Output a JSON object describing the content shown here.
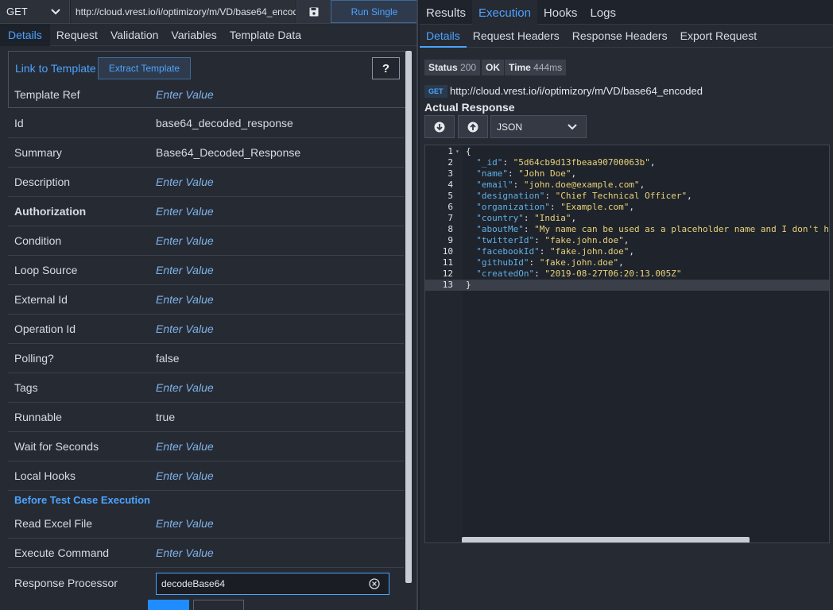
{
  "request_bar": {
    "method": "GET",
    "url": "http://cloud.vrest.io/i/optimizory/m/VD/base64_encoded",
    "run_label": "Run Single"
  },
  "left_tabs": [
    "Details",
    "Request",
    "Validation",
    "Variables",
    "Template Data"
  ],
  "template": {
    "link_label": "Link to Template",
    "extract_label": "Extract Template",
    "help_label": "?",
    "ref_label": "Template Ref",
    "ref_value": "Enter Value"
  },
  "fields": [
    {
      "label": "Id",
      "value": "base64_decoded_response"
    },
    {
      "label": "Summary",
      "value": "Base64_Decoded_Response"
    },
    {
      "label": "Description",
      "value": "Enter Value"
    },
    {
      "label": "Authorization",
      "value": "Enter Value"
    },
    {
      "label": "Condition",
      "value": "Enter Value"
    },
    {
      "label": "Loop Source",
      "value": "Enter Value"
    },
    {
      "label": "External Id",
      "value": "Enter Value"
    },
    {
      "label": "Operation Id",
      "value": "Enter Value"
    },
    {
      "label": "Polling?",
      "value": "false"
    },
    {
      "label": "Tags",
      "value": "Enter Value"
    },
    {
      "label": "Runnable",
      "value": "true"
    },
    {
      "label": "Wait for Seconds",
      "value": "Enter Value"
    },
    {
      "label": "Local Hooks",
      "value": "Enter Value"
    }
  ],
  "before_section": {
    "title": "Before Test Case Execution",
    "fields": [
      {
        "label": "Read Excel File",
        "value": "Enter Value"
      },
      {
        "label": "Execute Command",
        "value": "Enter Value"
      }
    ],
    "processor_label": "Response Processor",
    "processor_value": "decodeBase64"
  },
  "right_tabs": [
    "Results",
    "Execution",
    "Hooks",
    "Logs"
  ],
  "right_subtabs": [
    "Details",
    "Request Headers",
    "Response Headers",
    "Export Request"
  ],
  "status": {
    "status_label": "Status",
    "status_code": "200",
    "status_text": "OK",
    "time_label": "Time",
    "time_value": "444ms"
  },
  "request_line": {
    "method": "GET",
    "url": "http://cloud.vrest.io/i/optimizory/m/VD/base64_encoded"
  },
  "actual_response": {
    "title": "Actual Response",
    "format": "JSON"
  },
  "response_lines": [
    {
      "n": "1",
      "text": "{"
    },
    {
      "n": "2",
      "key": "\"_id\"",
      "val": "\"5d64cb9d13fbeaa90700063b\"",
      "end": ","
    },
    {
      "n": "3",
      "key": "\"name\"",
      "val": "\"John Doe\"",
      "end": ","
    },
    {
      "n": "4",
      "key": "\"email\"",
      "val": "\"john.doe@example.com\"",
      "end": ","
    },
    {
      "n": "5",
      "key": "\"designation\"",
      "val": "\"Chief Technical Officer\"",
      "end": ","
    },
    {
      "n": "6",
      "key": "\"organization\"",
      "val": "\"Example.com\"",
      "end": ","
    },
    {
      "n": "7",
      "key": "\"country\"",
      "val": "\"India\"",
      "end": ","
    },
    {
      "n": "8",
      "key": "\"aboutMe\"",
      "val": "\"My name can be used as a placeholder name and I don't ha",
      "end": ""
    },
    {
      "n": "9",
      "key": "\"twitterId\"",
      "val": "\"fake.john.doe\"",
      "end": ","
    },
    {
      "n": "10",
      "key": "\"facebookId\"",
      "val": "\"fake.john.doe\"",
      "end": ","
    },
    {
      "n": "11",
      "key": "\"githubId\"",
      "val": "\"fake.john.doe\"",
      "end": ","
    },
    {
      "n": "12",
      "key": "\"createdOn\"",
      "val": "\"2019-08-27T06:20:13.005Z\"",
      "end": ""
    },
    {
      "n": "13",
      "text": "}"
    }
  ]
}
